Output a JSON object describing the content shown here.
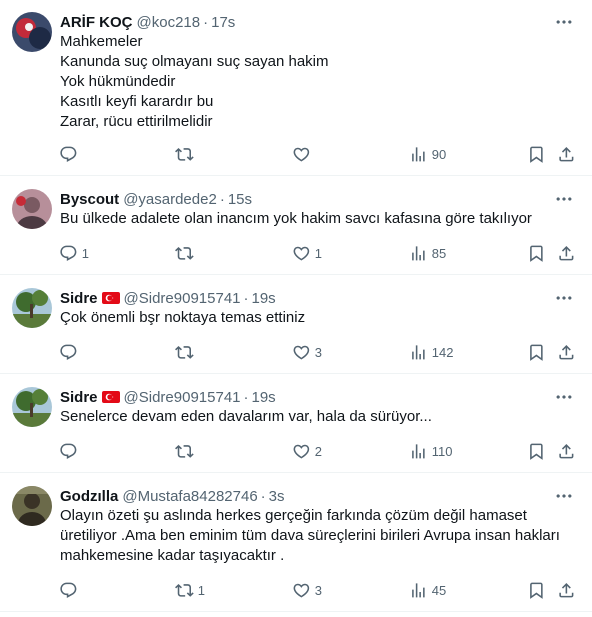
{
  "colors": {
    "text": "#0f1419",
    "secondary": "#536471",
    "divider": "#eff3f4"
  },
  "tweets": [
    {
      "name": "ARİF KOÇ",
      "handle": "@koc218",
      "sep": "·",
      "time": "17s",
      "lines": [
        "Mahkemeler",
        "Kanunda suç olmayanı suç sayan hakim",
        "Yok hükmündedir",
        "Kasıtlı keyfi karardır bu",
        "Zarar, rücu ettirilmelidir"
      ],
      "replies": "",
      "retweets": "",
      "likes": "",
      "views": "90"
    },
    {
      "name": "Byscout",
      "handle": "@yasardede2",
      "sep": "·",
      "time": "15s",
      "lines": [
        "Bu ülkede adalete olan inancım yok hakim savcı kafasına  göre takılıyor"
      ],
      "replies": "1",
      "retweets": "",
      "likes": "1",
      "views": "85"
    },
    {
      "name": "Sidre",
      "handle": "@Sidre90915741",
      "sep": "·",
      "time": "19s",
      "lines": [
        "Çok önemli bşr noktaya temas ettiniz"
      ],
      "replies": "",
      "retweets": "",
      "likes": "3",
      "views": "142"
    },
    {
      "name": "Sidre",
      "handle": "@Sidre90915741",
      "sep": "·",
      "time": "19s",
      "lines": [
        "Senelerce devam eden davalarım var, hala da sürüyor..."
      ],
      "replies": "",
      "retweets": "",
      "likes": "2",
      "views": "110"
    },
    {
      "name": "Godzılla",
      "handle": "@Mustafa84282746",
      "sep": "·",
      "time": "3s",
      "lines": [
        "Olayın özeti şu aslında herkes gerçeğin farkında çözüm değil hamaset",
        "üretiliyor .Ama ben eminim tüm dava süreçlerini birileri Avrupa insan hakları",
        "mahkemesine kadar taşıyacaktır ."
      ],
      "replies": "",
      "retweets": "1",
      "likes": "3",
      "views": "45"
    }
  ]
}
